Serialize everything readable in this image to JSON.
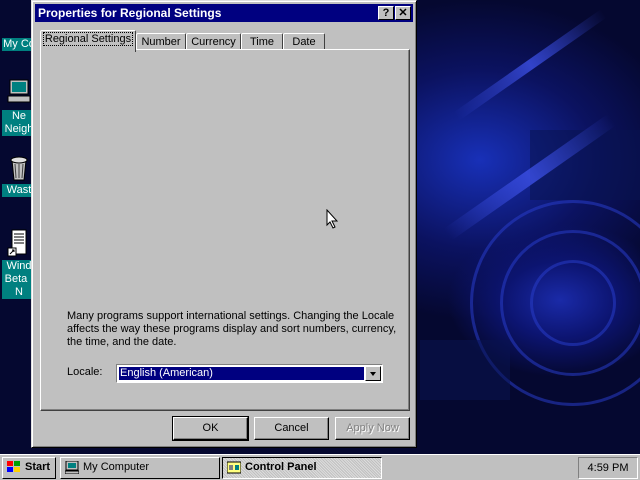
{
  "desktop": {
    "icons": [
      {
        "label": "My Co",
        "icon": "my-computer-icon"
      },
      {
        "label": "Ne",
        "label2": "Neigh",
        "icon": "network-neighborhood-icon"
      },
      {
        "label": "Wast",
        "icon": "wastebasket-icon"
      },
      {
        "label": "Wind",
        "label2": "Beta I",
        "label3": "N",
        "icon": "shortcut-icon"
      }
    ]
  },
  "dialog": {
    "title": "Properties for Regional Settings",
    "help_glyph": "?",
    "close_glyph": "✕",
    "tabs": [
      "Regional Settings",
      "Number",
      "Currency",
      "Time",
      "Date"
    ],
    "active_tab": "Regional Settings",
    "description": "Many programs support international settings. Changing the Locale affects the way these programs display and sort numbers, currency, the time, and the date.",
    "locale_label": "Locale:",
    "locale_value": "English (American)",
    "buttons": {
      "ok": "OK",
      "cancel": "Cancel",
      "apply": "Apply Now"
    }
  },
  "taskbar": {
    "start_label": "Start",
    "tasks": [
      {
        "label": "My Computer",
        "active": false
      },
      {
        "label": "Control Panel",
        "active": true
      }
    ],
    "clock": "4:59 PM"
  },
  "colors": {
    "title_bar": "#000080",
    "face": "#c0c0c0",
    "desktop_label": "#008080"
  }
}
